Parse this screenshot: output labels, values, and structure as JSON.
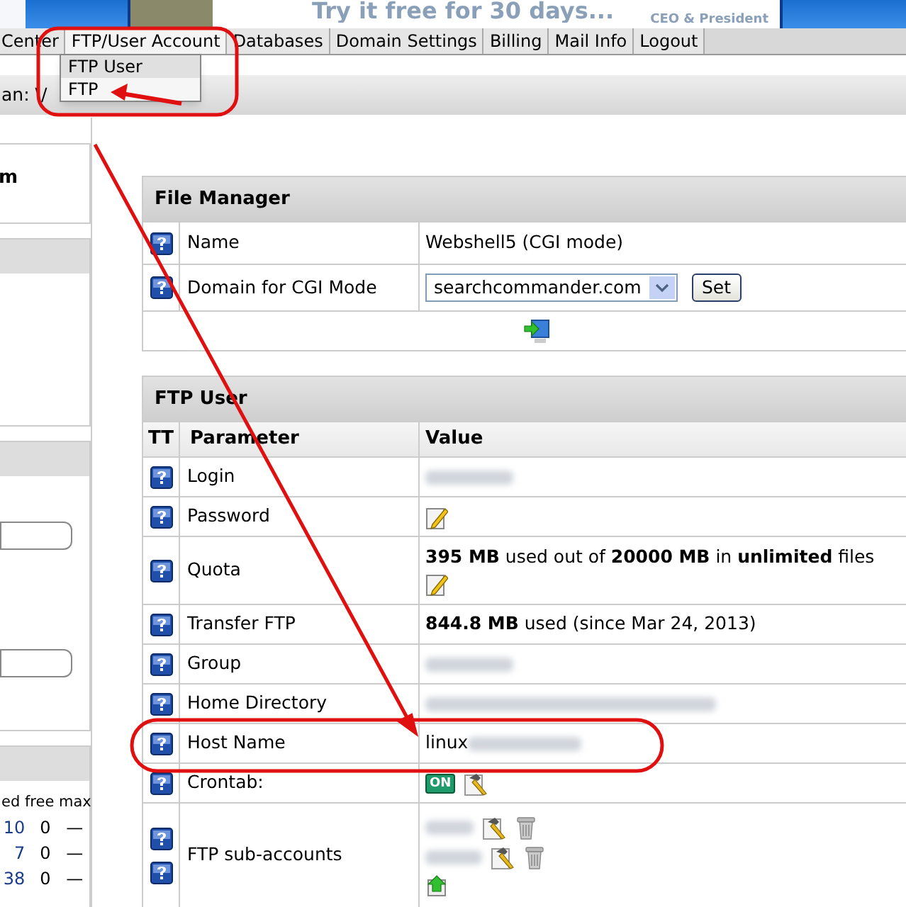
{
  "banner": {
    "tagline": "Try it free for 30 days...",
    "caption": "CEO & President"
  },
  "nav": {
    "tabs": [
      {
        "label": "Center",
        "selected": false
      },
      {
        "label": "FTP/User Account",
        "selected": true
      },
      {
        "label": "Databases",
        "selected": false
      },
      {
        "label": "Domain Settings",
        "selected": false
      },
      {
        "label": "Billing",
        "selected": false
      },
      {
        "label": "Mail Info",
        "selected": false
      },
      {
        "label": "Logout",
        "selected": false
      }
    ]
  },
  "dropdown": {
    "items": [
      {
        "label": "FTP User",
        "selected": true
      },
      {
        "label": "FTP",
        "selected": false
      }
    ]
  },
  "breadcrumb": "an: \\/",
  "sidebar": {
    "title": "m",
    "stats": {
      "header": "ed free max",
      "rows": [
        [
          "10",
          "0",
          "—"
        ],
        [
          "7",
          "0",
          "—"
        ],
        [
          "38",
          "0",
          "—"
        ]
      ]
    }
  },
  "file_manager": {
    "title": "File Manager",
    "rows": [
      {
        "kind": "text",
        "label": "Name",
        "value": "Webshell5 (CGI mode)"
      },
      {
        "kind": "select",
        "label": "Domain for CGI Mode",
        "value": "searchcommander.com",
        "button": "Set"
      }
    ]
  },
  "ftp_user": {
    "title": "FTP User",
    "columns": [
      "TT",
      "Parameter",
      "Value"
    ],
    "rows": [
      {
        "kind": "blurred",
        "label": "Login"
      },
      {
        "kind": "edit",
        "label": "Password"
      },
      {
        "kind": "quota",
        "label": "Quota",
        "value": "**395 MB** used out of **20000 MB** in **unlimited** files"
      },
      {
        "kind": "text",
        "label": "Transfer FTP",
        "value": "**844.8 MB** used (since Mar 24, 2013)"
      },
      {
        "kind": "blurred",
        "label": "Group"
      },
      {
        "kind": "blurred_long",
        "label": "Home Directory"
      },
      {
        "kind": "host",
        "label": "Host Name",
        "value": "linux"
      },
      {
        "kind": "crontab",
        "label": "Crontab:",
        "badge": "ON"
      },
      {
        "kind": "subaccounts",
        "label": "FTP sub-accounts"
      }
    ]
  }
}
